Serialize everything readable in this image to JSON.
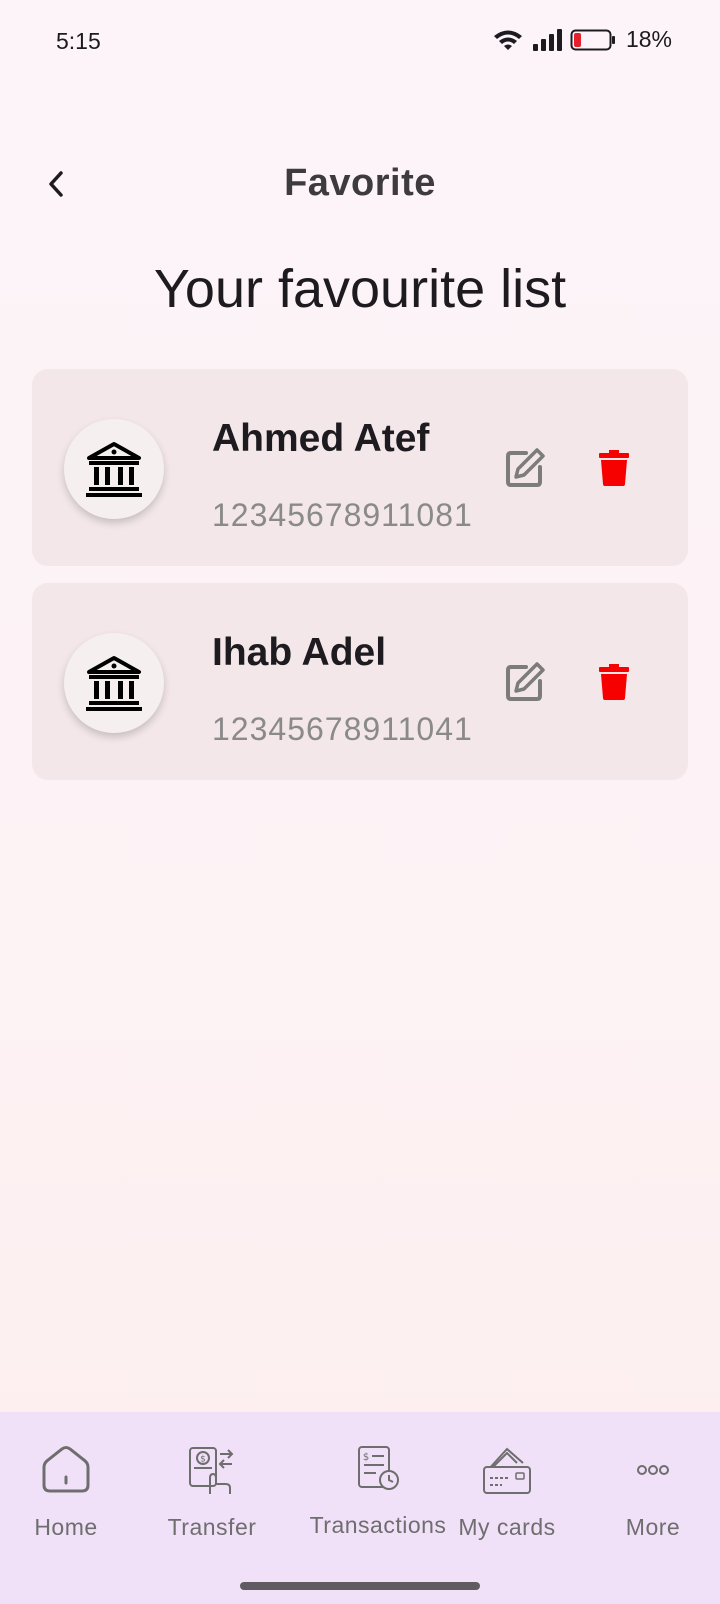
{
  "status": {
    "time": "5:15",
    "battery_pct": "18%",
    "icons": [
      "wifi-icon",
      "signal-icon",
      "battery-icon"
    ]
  },
  "header": {
    "title": "Favorite",
    "back_icon": "chevron-left-icon"
  },
  "section_title": "Your favourite list",
  "favorites": [
    {
      "name": "Ahmed Atef",
      "account": "12345678911081",
      "icon": "bank-icon"
    },
    {
      "name": "Ihab Adel",
      "account": "12345678911041",
      "icon": "bank-icon"
    }
  ],
  "actions": {
    "edit_icon": "edit-icon",
    "delete_icon": "trash-icon"
  },
  "colors": {
    "delete": "#f70000",
    "edit": "#7c7c7c",
    "card": "#f3e7e9",
    "nav_bg": "#f1e1f8"
  },
  "nav": [
    {
      "label": "Home",
      "icon": "home-icon"
    },
    {
      "label": "Transfer",
      "icon": "transfer-icon"
    },
    {
      "label": "Transactions",
      "icon": "transactions-icon"
    },
    {
      "label": "My cards",
      "icon": "cards-icon"
    },
    {
      "label": "More",
      "icon": "more-icon"
    }
  ]
}
